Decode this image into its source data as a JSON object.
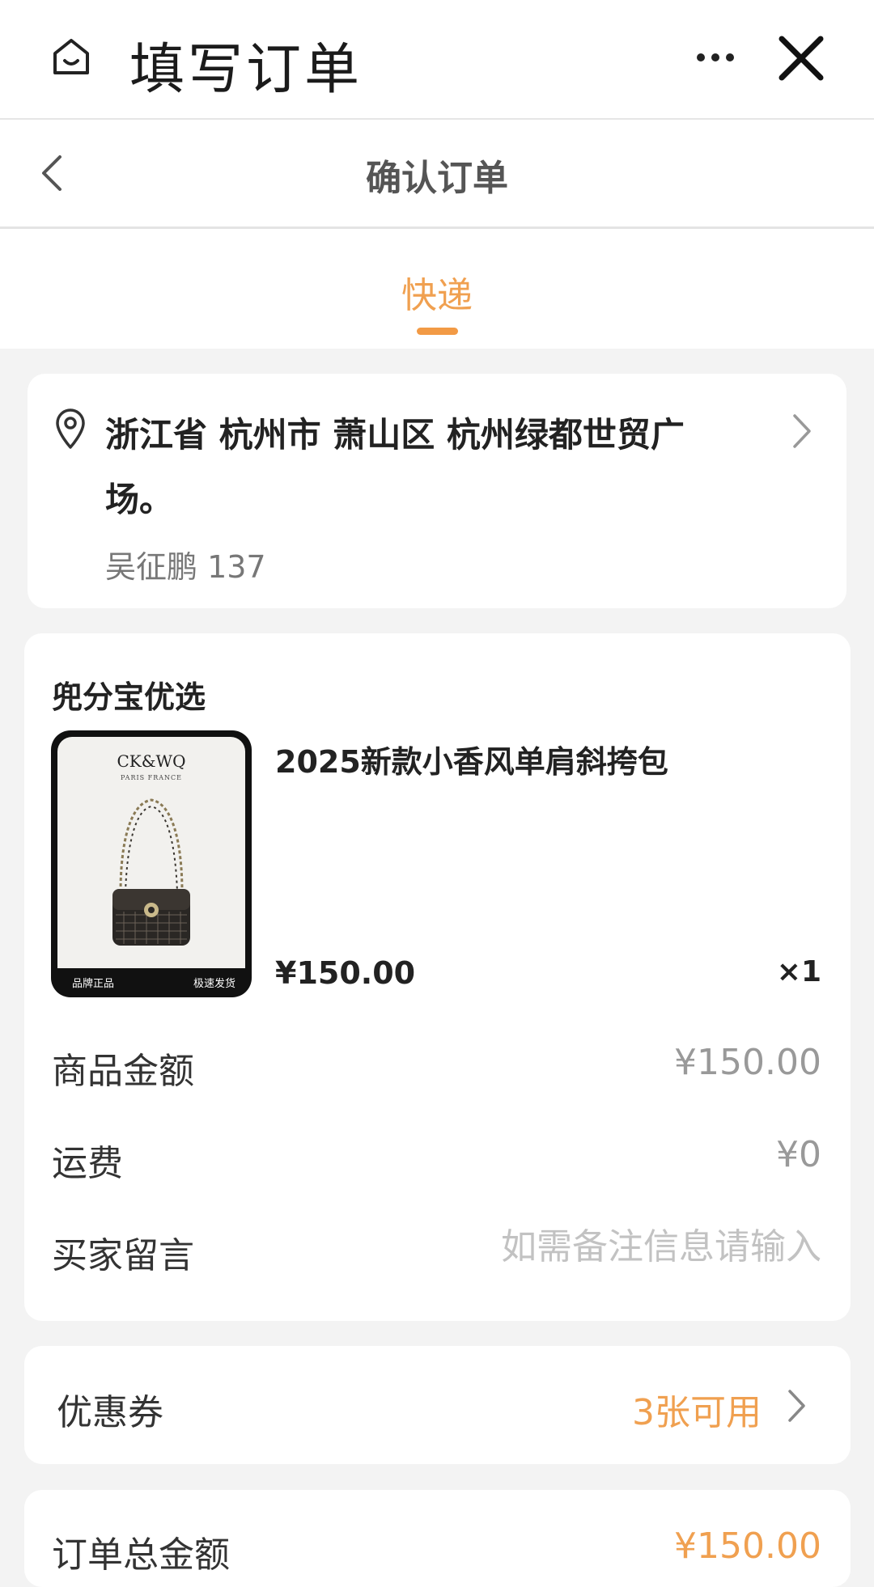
{
  "topbar": {
    "title": "填写订单",
    "icons": [
      "home-icon",
      "more-icon",
      "close-icon"
    ]
  },
  "navbar": {
    "title": "确认订单",
    "back_icon": "back-chevron-icon"
  },
  "tabs": {
    "active": "快递"
  },
  "address": {
    "line": "浙江省 杭州市 萧山区 杭州绿都世贸广场。",
    "receiver": "吴征鹏 137"
  },
  "order": {
    "shop_name": "兜分宝优选",
    "product": {
      "title": "2025新款小香风单肩斜挎包",
      "price": "¥150.00",
      "quantity": "×1",
      "thumb_brand": "CK&WQ",
      "thumb_sub": "PARIS FRANCE",
      "thumb_badge_left": "品牌正品",
      "thumb_badge_right": "极速发货"
    },
    "rows": {
      "goods_amount_label": "商品金额",
      "goods_amount_value": "¥150.00",
      "shipping_label": "运费",
      "shipping_value": "¥0",
      "message_label": "买家留言",
      "message_placeholder": "如需备注信息请输入"
    }
  },
  "coupon": {
    "label": "优惠券",
    "value": "3张可用"
  },
  "total": {
    "label": "订单总金额",
    "value": "¥150.00"
  },
  "colors": {
    "accent": "#f0a050",
    "background": "#f3f3f3",
    "card": "#ffffff"
  }
}
